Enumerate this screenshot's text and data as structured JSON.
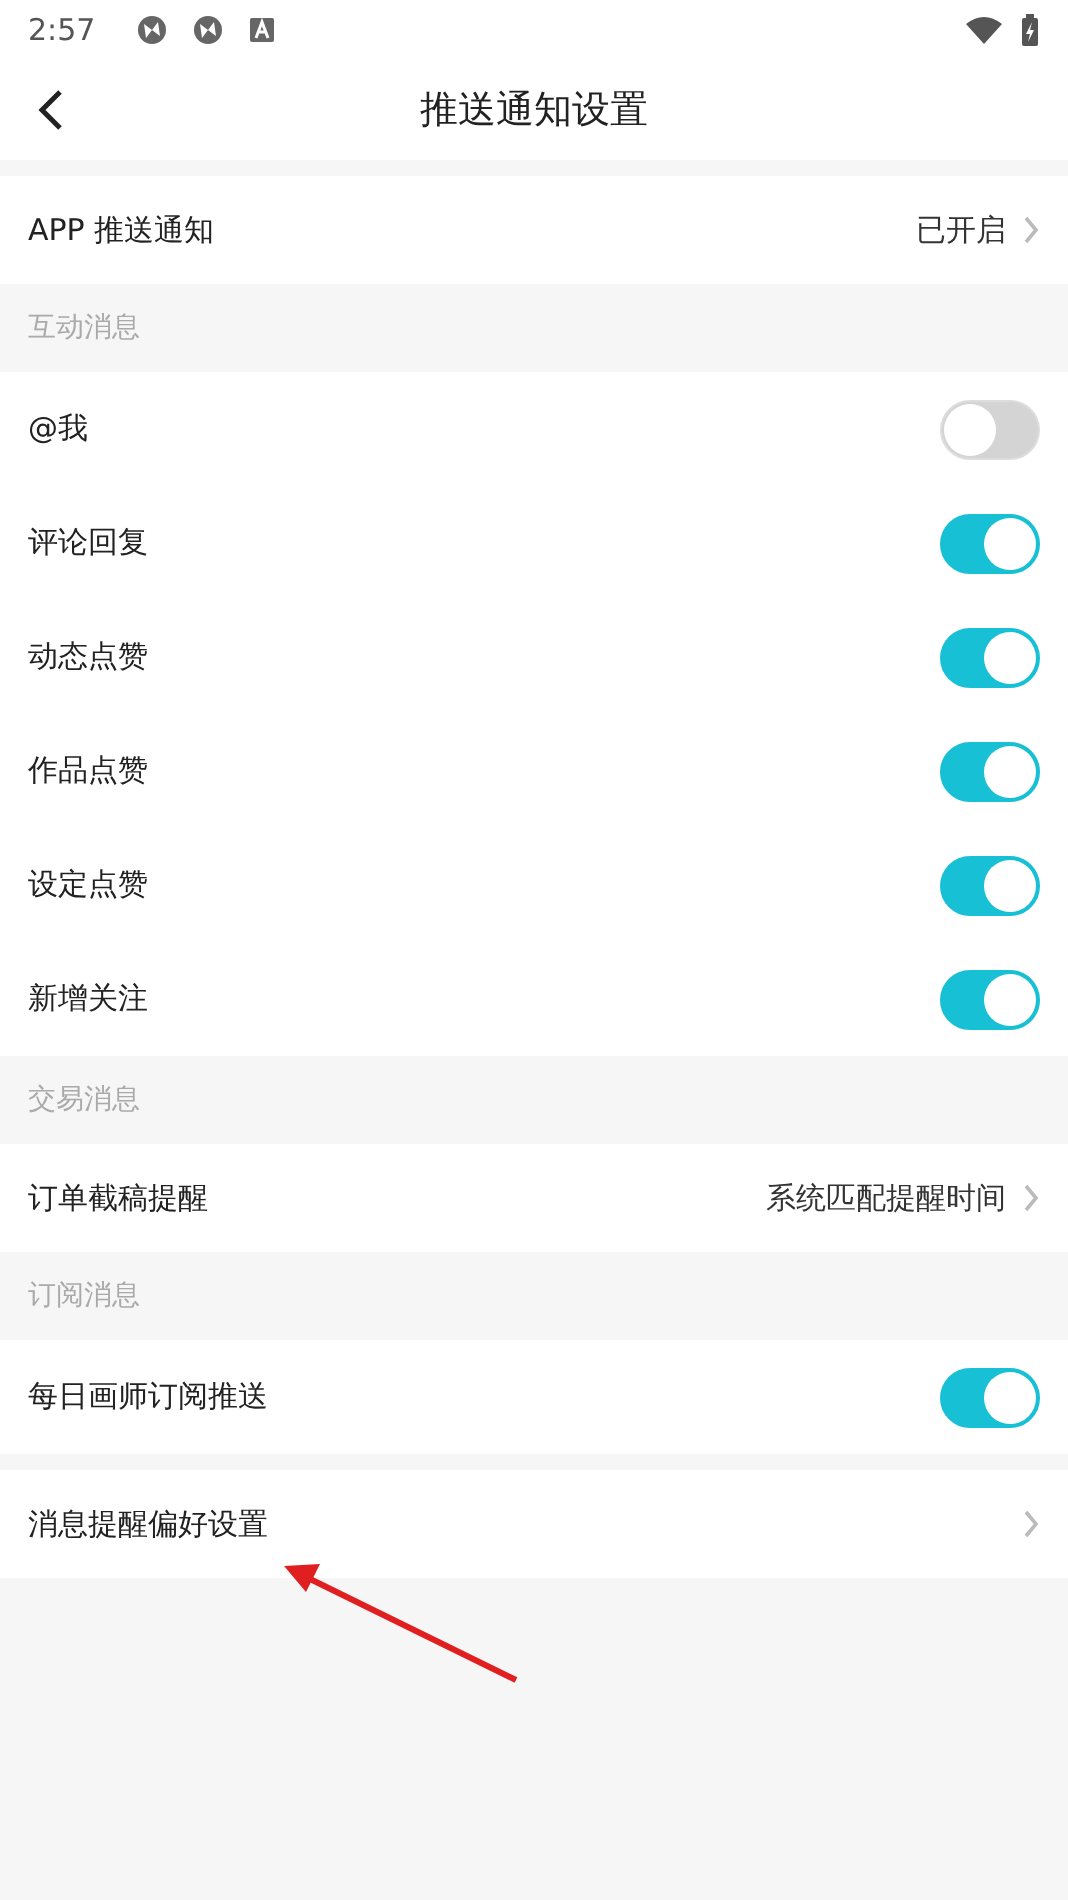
{
  "status_bar": {
    "time": "2:57"
  },
  "header": {
    "title": "推送通知设置"
  },
  "groups": [
    {
      "items": [
        {
          "kind": "link",
          "label": "APP 推送通知",
          "value": "已开启"
        }
      ]
    },
    {
      "heading": "互动消息",
      "items": [
        {
          "kind": "toggle",
          "label": "@我",
          "on": false
        },
        {
          "kind": "toggle",
          "label": "评论回复",
          "on": true
        },
        {
          "kind": "toggle",
          "label": "动态点赞",
          "on": true
        },
        {
          "kind": "toggle",
          "label": "作品点赞",
          "on": true
        },
        {
          "kind": "toggle",
          "label": "设定点赞",
          "on": true
        },
        {
          "kind": "toggle",
          "label": "新增关注",
          "on": true
        }
      ]
    },
    {
      "heading": "交易消息",
      "items": [
        {
          "kind": "link",
          "label": "订单截稿提醒",
          "value": "系统匹配提醒时间"
        }
      ]
    },
    {
      "heading": "订阅消息",
      "items": [
        {
          "kind": "toggle",
          "label": "每日画师订阅推送",
          "on": true
        }
      ]
    },
    {
      "items": [
        {
          "kind": "link",
          "label": "消息提醒偏好设置"
        }
      ]
    }
  ],
  "annotation": {
    "kind": "arrow"
  }
}
